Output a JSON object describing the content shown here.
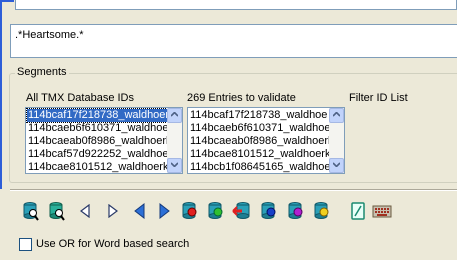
{
  "query": {
    "value": ".*Heartsome.*"
  },
  "segments": {
    "title": "Segments",
    "db_ids": {
      "label": "All TMX Database IDs",
      "items": [
        "114bcaf17f218738_waldhoer",
        "114bcaeb6f610371_waldhoe",
        "114bcaeab0f8986_waldhoerl",
        "114bcaf57d922252_waldhoe",
        "114bcae8101512_waldhoerk"
      ],
      "selected_index": 0
    },
    "entries": {
      "label": "269 Entries to validate",
      "items": [
        "114bcaf17f218738_waldhoe",
        "114bcaeb6f610371_waldhoe",
        "114bcaeab0f8986_waldhoerl",
        "114bcae8101512_waldhoerk",
        "114bcb1f08645165_waldhoe"
      ]
    },
    "filter": {
      "label": "Filter ID List"
    }
  },
  "toolbar": {
    "icons": [
      "search-db-icon",
      "search-db-green-icon",
      "arrow-left-icon",
      "arrow-right-icon",
      "arrow-left-blue-icon",
      "arrow-right-blue-icon",
      "db-red-search-icon",
      "db-green-search-icon",
      "db-export-red-icon",
      "db-blue-search-icon",
      "db-purple-search-icon",
      "db-yellow-search-icon",
      "document-edit-icon",
      "keyboard-icon"
    ]
  },
  "options": {
    "or_label": "Use OR for Word based search",
    "or_checked": false
  }
}
